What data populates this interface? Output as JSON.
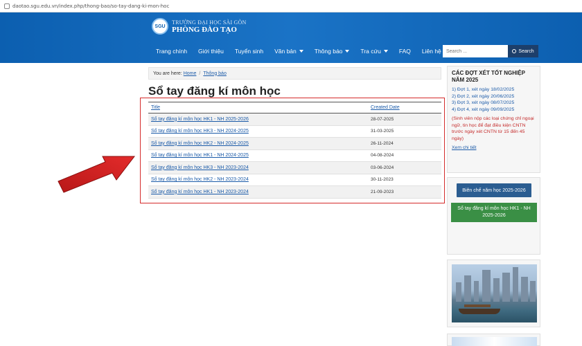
{
  "browser": {
    "url": "daotao.sgu.edu.vn/index.php/thong-bao/so-tay-dang-ki-mon-hoc"
  },
  "header": {
    "logo_mark": "SGU",
    "logo_line1": "TRƯỜNG ĐẠI HỌC SÀI GÒN",
    "logo_line2": "PHÒNG ĐÀO TẠO"
  },
  "nav": {
    "items": [
      {
        "label": "Trang chính",
        "dropdown": false
      },
      {
        "label": "Giới thiệu",
        "dropdown": false
      },
      {
        "label": "Tuyển sinh",
        "dropdown": false
      },
      {
        "label": "Văn bản",
        "dropdown": true
      },
      {
        "label": "Thông báo",
        "dropdown": true
      },
      {
        "label": "Tra cứu",
        "dropdown": true
      },
      {
        "label": "FAQ",
        "dropdown": false
      },
      {
        "label": "Liên hệ",
        "dropdown": false
      }
    ]
  },
  "search": {
    "placeholder": "Search ...",
    "button_label": "Search"
  },
  "breadcrumb": {
    "prefix": "You are here:",
    "home": "Home",
    "sep": "/",
    "current": "Thông báo"
  },
  "page": {
    "title": "Sổ tay đăng kí môn học"
  },
  "table": {
    "col_title": "Title",
    "col_date": "Created Date",
    "rows": [
      {
        "title": "Sổ tay đăng kí môn học HK1 - NH 2025-2026",
        "date": "28-07-2025"
      },
      {
        "title": "Sổ tay đăng kí môn học HK3 - NH 2024-2025",
        "date": "31-03-2025"
      },
      {
        "title": "Sổ tay đăng kí môn học HK2 - NH 2024-2025",
        "date": "26-11-2024"
      },
      {
        "title": "Sổ tay đăng kí môn học HK1 - NH 2024-2025",
        "date": "04-08-2024"
      },
      {
        "title": "Sổ tay đăng kí môn học HK3 - NH 2023-2024",
        "date": "03-06-2024"
      },
      {
        "title": "Sổ tay đăng kí môn học HK2 - NH 2023-2024",
        "date": "30-11-2023"
      },
      {
        "title": "Sổ tay đăng kí môn học HK1 - NH 2023-2024",
        "date": "21-09-2023"
      }
    ]
  },
  "sidebar": {
    "heading": "CÁC ĐỢT XÉT TỐT NGHIỆP NĂM 2025",
    "rounds": [
      "1) Đợt 1, xét ngày 18/02/2025",
      "2) Đợt 2, xét ngày 20/06/2025",
      "3) Đợt 3, xét ngày 08/07/2025",
      "4) Đợt 4, xét ngày 09/09/2025"
    ],
    "note": "(Sinh viên nộp các loại chứng chỉ ngoại ngữ, tin học để đạt điều kiện CNTN trước ngày xét CNTN từ 15 đến 45 ngày)",
    "more": "Xem chi tiết",
    "btn_blue": "Biên chế năm học 2025-2026",
    "btn_green": "Sổ tay đăng kí môn học HK1 - NH 2025-2026"
  },
  "colors": {
    "header_blue": "#1a73c6",
    "link_blue": "#1a5aa8",
    "highlight_red": "#d42a2a",
    "button_green": "#3a8f45"
  }
}
